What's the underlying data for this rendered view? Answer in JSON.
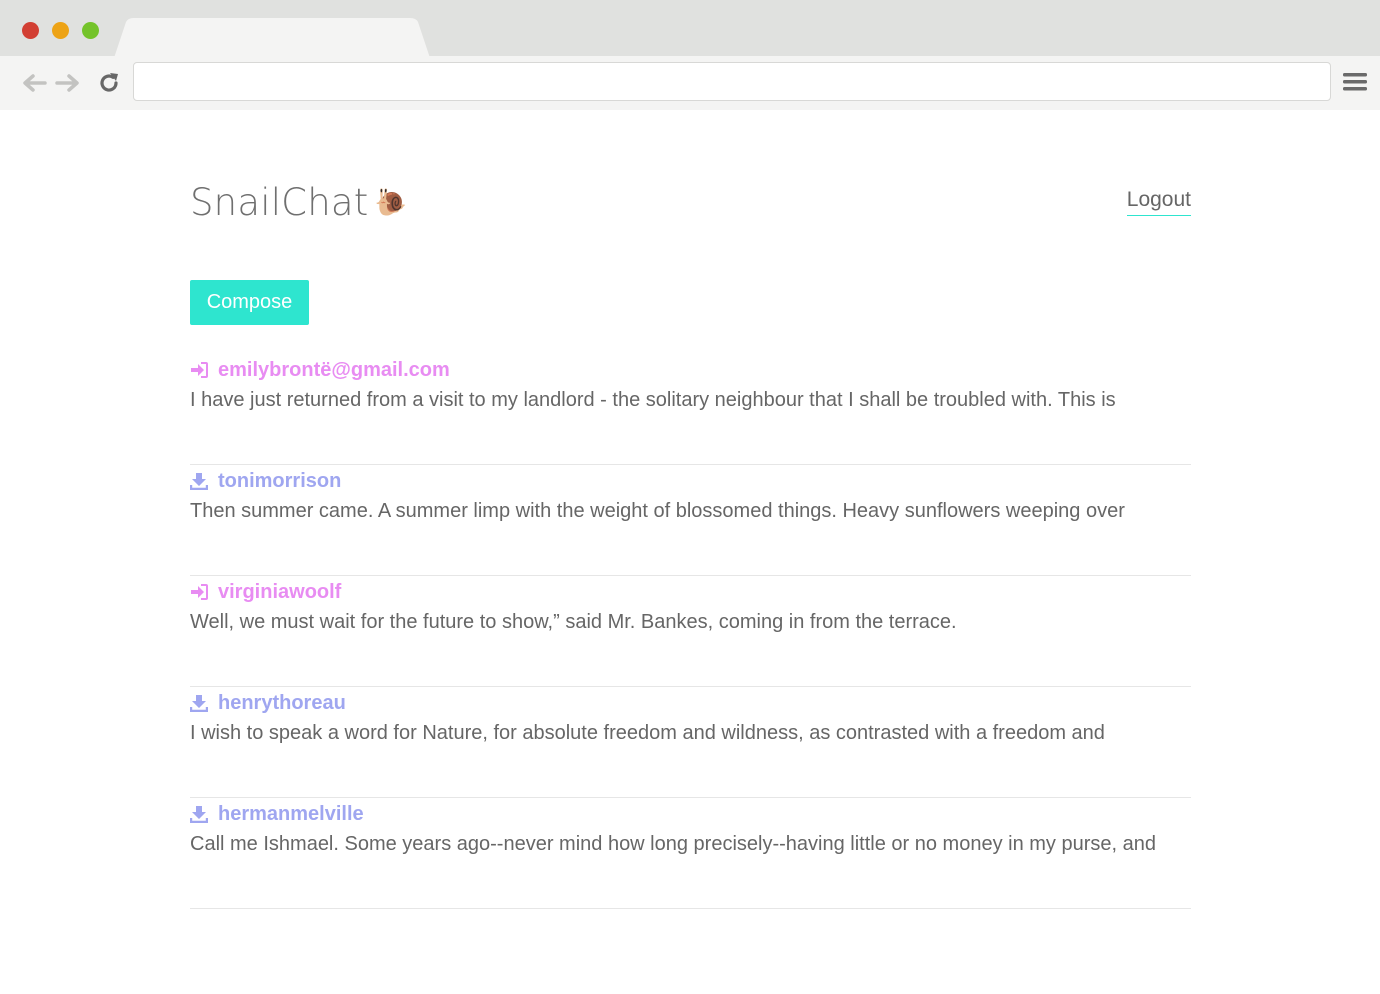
{
  "app": {
    "title": "SnailChat",
    "emoji": "🐌",
    "accent_color": "#2ee5cf",
    "received_color": "#e88cf2",
    "sent_color": "#9fa6f0"
  },
  "header": {
    "logout_label": "Logout"
  },
  "toolbar": {
    "compose_label": "Compose"
  },
  "messages": [
    {
      "direction": "received",
      "icon": "sign-in-icon",
      "sender": "emilybrontë@gmail.com",
      "preview": "I have just returned from a visit to my landlord - the solitary neighbour that I shall be troubled with. This is"
    },
    {
      "direction": "sent",
      "icon": "download-icon",
      "sender": "tonimorrison",
      "preview": "Then summer came. A summer limp with the weight of blossomed things. Heavy sunflowers weeping over"
    },
    {
      "direction": "received",
      "icon": "sign-in-icon",
      "sender": "virginiawoolf",
      "preview": "Well, we must wait for the future to show,” said Mr. Bankes, coming in from the terrace."
    },
    {
      "direction": "sent",
      "icon": "download-icon",
      "sender": "henrythoreau",
      "preview": "I wish to speak a word for Nature, for absolute freedom and wildness, as contrasted with a freedom and"
    },
    {
      "direction": "sent",
      "icon": "download-icon",
      "sender": "hermanmelville",
      "preview": "Call me Ishmael. Some years ago--never mind how long precisely--having little or no money in my purse, and"
    }
  ]
}
